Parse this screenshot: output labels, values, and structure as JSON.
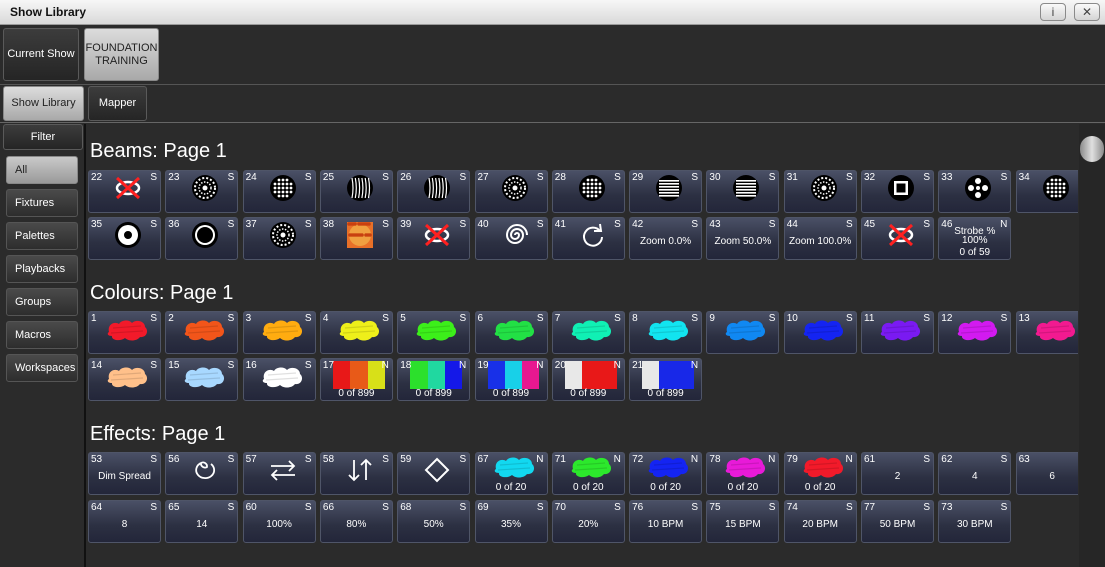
{
  "window": {
    "title": "Show Library",
    "info_btn": "i",
    "close_btn": "✕"
  },
  "top_tabs": [
    {
      "label": "Current Show",
      "selected": false
    },
    {
      "label": "FOUNDATION TRAINING",
      "selected": true
    }
  ],
  "sub_tabs": [
    {
      "label": "Show Library",
      "selected": true
    },
    {
      "label": "Mapper",
      "selected": false
    }
  ],
  "filter_label": "Filter",
  "sidebar": [
    {
      "label": "All",
      "selected": true
    },
    {
      "label": "Fixtures",
      "selected": false
    },
    {
      "label": "Palettes",
      "selected": false
    },
    {
      "label": "Playbacks",
      "selected": false
    },
    {
      "label": "Groups",
      "selected": false
    },
    {
      "label": "Macros",
      "selected": false
    },
    {
      "label": "Workspaces",
      "selected": false
    }
  ],
  "sections": [
    {
      "title": "Beams: Page 1",
      "rows": [
        [
          {
            "num": "22",
            "flag": "S",
            "icon": "gobo-cross"
          },
          {
            "num": "23",
            "flag": "S",
            "icon": "gobo-breakup"
          },
          {
            "num": "24",
            "flag": "S",
            "icon": "gobo-dots"
          },
          {
            "num": "25",
            "flag": "S",
            "icon": "gobo-lines"
          },
          {
            "num": "26",
            "flag": "S",
            "icon": "gobo-lines"
          },
          {
            "num": "27",
            "flag": "S",
            "icon": "gobo-breakup"
          },
          {
            "num": "28",
            "flag": "S",
            "icon": "gobo-dots"
          },
          {
            "num": "29",
            "flag": "S",
            "icon": "gobo-stripes"
          },
          {
            "num": "30",
            "flag": "S",
            "icon": "gobo-stripes"
          },
          {
            "num": "31",
            "flag": "S",
            "icon": "gobo-breakup"
          },
          {
            "num": "32",
            "flag": "S",
            "icon": "gobo-square"
          },
          {
            "num": "33",
            "flag": "S",
            "icon": "gobo-circles"
          },
          {
            "num": "34",
            "flag": "S",
            "icon": "gobo-dots"
          }
        ],
        [
          {
            "num": "35",
            "flag": "S",
            "icon": "gobo-swirl"
          },
          {
            "num": "36",
            "flag": "S",
            "icon": "gobo-ring"
          },
          {
            "num": "37",
            "flag": "S",
            "icon": "gobo-breakup"
          },
          {
            "num": "38",
            "flag": "S",
            "icon": "gobo-texture"
          },
          {
            "num": "39",
            "flag": "S",
            "icon": "rotate-cross"
          },
          {
            "num": "40",
            "flag": "S",
            "icon": "spiral"
          },
          {
            "num": "41",
            "flag": "S",
            "icon": "rotate-arrow"
          },
          {
            "num": "42",
            "flag": "S",
            "label": "Zoom 0.0%"
          },
          {
            "num": "43",
            "flag": "S",
            "label": "Zoom 50.0%"
          },
          {
            "num": "44",
            "flag": "S",
            "label": "Zoom 100.0%"
          },
          {
            "num": "45",
            "flag": "S",
            "icon": "rotate-cross"
          },
          {
            "num": "46",
            "flag": "N",
            "label": "Strobe %\n100%",
            "sub": "0 of 59"
          }
        ]
      ]
    },
    {
      "title": "Colours: Page 1",
      "rows": [
        [
          {
            "num": "1",
            "flag": "S",
            "color": "#f21a2a"
          },
          {
            "num": "2",
            "flag": "S",
            "color": "#f2551a"
          },
          {
            "num": "3",
            "flag": "S",
            "color": "#ffac10"
          },
          {
            "num": "4",
            "flag": "S",
            "color": "#eeef1a"
          },
          {
            "num": "5",
            "flag": "S",
            "color": "#3cef1a"
          },
          {
            "num": "6",
            "flag": "S",
            "color": "#22e045"
          },
          {
            "num": "7",
            "flag": "S",
            "color": "#10f0b4"
          },
          {
            "num": "8",
            "flag": "S",
            "color": "#12e4f0"
          },
          {
            "num": "9",
            "flag": "S",
            "color": "#1088f2"
          },
          {
            "num": "10",
            "flag": "S",
            "color": "#1424f2"
          },
          {
            "num": "11",
            "flag": "S",
            "color": "#7a1af2"
          },
          {
            "num": "12",
            "flag": "S",
            "color": "#d21af0"
          },
          {
            "num": "13",
            "flag": "S",
            "color": "#f21a90"
          }
        ],
        [
          {
            "num": "14",
            "flag": "S",
            "color": "#ffc08a"
          },
          {
            "num": "15",
            "flag": "S",
            "color": "#a8d8ff"
          },
          {
            "num": "16",
            "flag": "S",
            "color": "#ffffff"
          },
          {
            "num": "17",
            "flag": "N",
            "bars": [
              "#e81818",
              "#e85a18",
              "#d8e018"
            ],
            "sub": "0 of 899"
          },
          {
            "num": "18",
            "flag": "N",
            "bars": [
              "#2ce02c",
              "#20d8a0",
              "#1418e8"
            ],
            "sub": "0 of 899"
          },
          {
            "num": "19",
            "flag": "N",
            "bars": [
              "#1830e8",
              "#18d0e8",
              "#e81890"
            ],
            "sub": "0 of 899"
          },
          {
            "num": "20",
            "flag": "N",
            "bars": [
              "#e8e8e8",
              "#e81818",
              "#e81818"
            ],
            "sub": "0 of 899"
          },
          {
            "num": "21",
            "flag": "N",
            "bars": [
              "#e8e8e8",
              "#1828e8",
              "#1828e8"
            ],
            "sub": "0 of 899"
          }
        ]
      ]
    },
    {
      "title": "Effects: Page 1",
      "rows": [
        [
          {
            "num": "53",
            "flag": "S",
            "label": "Dim Spread"
          },
          {
            "num": "56",
            "flag": "S",
            "icon": "circle-loop"
          },
          {
            "num": "57",
            "flag": "S",
            "icon": "swap-arrows"
          },
          {
            "num": "58",
            "flag": "S",
            "icon": "up-down-arrows"
          },
          {
            "num": "59",
            "flag": "S",
            "icon": "diamond"
          },
          {
            "num": "67",
            "flag": "N",
            "color": "#12d8f0",
            "sub": "0 of 20"
          },
          {
            "num": "71",
            "flag": "N",
            "color": "#2ce82c",
            "sub": "0 of 20"
          },
          {
            "num": "72",
            "flag": "N",
            "color": "#1424f2",
            "sub": "0 of 20"
          },
          {
            "num": "78",
            "flag": "N",
            "color": "#e81ad8",
            "sub": "0 of 20"
          },
          {
            "num": "79",
            "flag": "N",
            "color": "#f21a2a",
            "sub": "0 of 20"
          },
          {
            "num": "61",
            "flag": "S",
            "label": "2"
          },
          {
            "num": "62",
            "flag": "S",
            "label": "4"
          },
          {
            "num": "63",
            "flag": "S",
            "label": "6"
          }
        ],
        [
          {
            "num": "64",
            "flag": "S",
            "label": "8"
          },
          {
            "num": "65",
            "flag": "S",
            "label": "14"
          },
          {
            "num": "60",
            "flag": "S",
            "label": "100%"
          },
          {
            "num": "66",
            "flag": "S",
            "label": "80%"
          },
          {
            "num": "68",
            "flag": "S",
            "label": "50%"
          },
          {
            "num": "69",
            "flag": "S",
            "label": "35%"
          },
          {
            "num": "70",
            "flag": "S",
            "label": "20%"
          },
          {
            "num": "76",
            "flag": "S",
            "label": "10 BPM"
          },
          {
            "num": "75",
            "flag": "S",
            "label": "15 BPM"
          },
          {
            "num": "74",
            "flag": "S",
            "label": "20 BPM"
          },
          {
            "num": "77",
            "flag": "S",
            "label": "50 BPM"
          },
          {
            "num": "73",
            "flag": "S",
            "label": "30 BPM"
          }
        ]
      ]
    }
  ]
}
